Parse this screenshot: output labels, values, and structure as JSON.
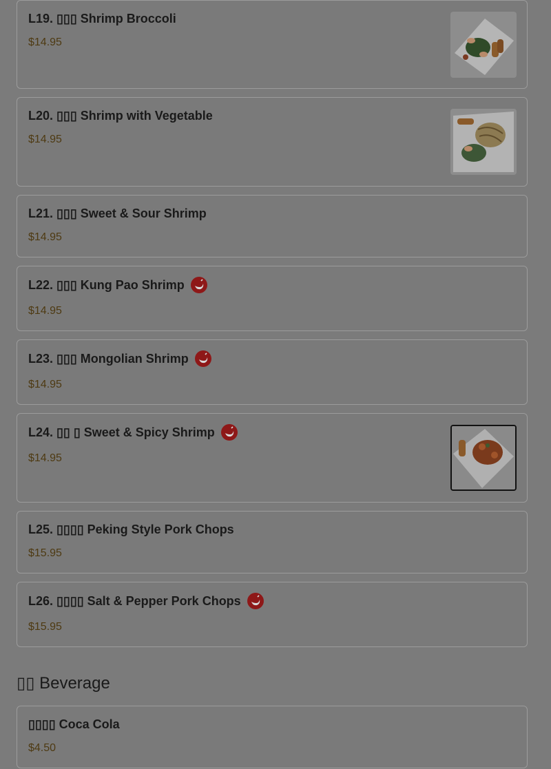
{
  "menu": {
    "items": [
      {
        "title": "L19. ▯▯▯ Shrimp Broccoli",
        "price": "$14.95",
        "spicy": false,
        "photo": "shrimp-broccoli-photo"
      },
      {
        "title": "L20. ▯▯▯ Shrimp with Vegetable",
        "price": "$14.95",
        "spicy": false,
        "photo": "shrimp-vegetable-photo"
      },
      {
        "title": "L21. ▯▯▯ Sweet & Sour Shrimp",
        "price": "$14.95",
        "spicy": false
      },
      {
        "title": "L22. ▯▯▯ Kung Pao Shrimp",
        "price": "$14.95",
        "spicy": true
      },
      {
        "title": "L23. ▯▯▯ Mongolian Shrimp",
        "price": "$14.95",
        "spicy": true
      },
      {
        "title": "L24. ▯▯ ▯ Sweet & Spicy Shrimp",
        "price": "$14.95",
        "spicy": true,
        "photo": "sweet-spicy-shrimp-photo"
      },
      {
        "title": "L25. ▯▯▯▯ Peking Style Pork Chops",
        "price": "$15.95",
        "spicy": false
      },
      {
        "title": "L26. ▯▯▯▯ Salt & Pepper Pork Chops",
        "price": "$15.95",
        "spicy": true
      }
    ]
  },
  "beverage": {
    "section_title": "▯▯ Beverage",
    "items": [
      {
        "title": "▯▯▯▯ Coca Cola",
        "price": "$4.50"
      }
    ]
  },
  "icons": {
    "spicy": "chili-pepper-icon"
  },
  "colors": {
    "price": "#4e3a12",
    "spicy_badge": "#8e1818",
    "overlay": "#7b7b7b"
  }
}
